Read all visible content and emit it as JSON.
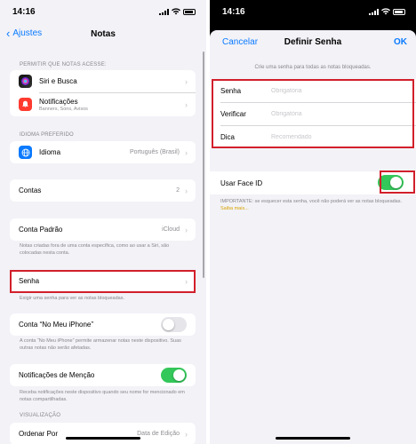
{
  "left": {
    "status": {
      "time": "14:16"
    },
    "nav": {
      "back_label": "Ajustes",
      "title": "Notas"
    },
    "sections": {
      "access_header": "PERMITIR QUE NOTAS ACESSE:",
      "siri_label": "Siri e Busca",
      "notifications_label": "Notificações",
      "notifications_sub": "Banners, Sons, Avisos",
      "language_header": "IDIOMA PREFERIDO",
      "language_label": "Idioma",
      "language_value": "Português (Brasil)",
      "accounts_label": "Contas",
      "accounts_value": "2",
      "default_account_label": "Conta Padrão",
      "default_account_value": "iCloud",
      "default_account_footer": "Notas criadas fora de uma conta específica, como ao usar a Siri, são colocadas nesta conta.",
      "password_label": "Senha",
      "password_footer": "Exigir uma senha para ver as notas bloqueadas.",
      "on_iphone_label": "Conta “No Meu iPhone”",
      "on_iphone_footer": "A conta “No Meu iPhone” permite armazenar notas neste dispositivo. Suas outras notas não serão afetadas.",
      "mention_label": "Notificações de Menção",
      "mention_footer": "Receba notificações neste dispositivo quando seu nome for mencionado em notas compartilhadas.",
      "view_header": "VISUALIZAÇÃO",
      "sort_label": "Ordenar Por",
      "sort_value": "Data de Edição"
    },
    "toggles": {
      "on_iphone": false,
      "mentions": true
    }
  },
  "right": {
    "status": {
      "time": "14:16"
    },
    "nav": {
      "cancel_label": "Cancelar",
      "title": "Definir Senha",
      "ok_label": "OK"
    },
    "hint": "Crie uma senha para todas as notas bloqueadas.",
    "fields": [
      {
        "label": "Senha",
        "placeholder": "Obrigatória"
      },
      {
        "label": "Verificar",
        "placeholder": "Obrigatória"
      },
      {
        "label": "Dica",
        "placeholder": "Recomendado"
      }
    ],
    "face_id_label": "Usar Face ID",
    "face_id_on": true,
    "important_note": "IMPORTANTE: se esquecer esta senha, você não poderá ver as notas bloqueadas.",
    "learn_more": "Saiba mais..."
  },
  "colors": {
    "accent_blue": "#0a7aff",
    "toggle_green": "#34c759",
    "highlight_red": "#d21f2b",
    "link_yellow": "#d9a400"
  }
}
